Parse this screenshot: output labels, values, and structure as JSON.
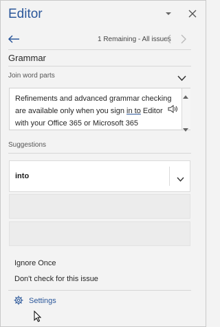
{
  "header": {
    "title": "Editor"
  },
  "navigation": {
    "issues_status": "1 Remaining - All issues"
  },
  "section": {
    "title": "Grammar",
    "error_type": "Join word parts"
  },
  "context": {
    "line1": "Refinements and advanced grammar checking",
    "line2_before": "are available only when you sign ",
    "line2_flagged": "in to",
    "line2_after": " Editor",
    "line3": "with your Office 365 or Microsoft 365"
  },
  "suggestions": {
    "label": "Suggestions",
    "items": [
      {
        "text": "into"
      }
    ]
  },
  "actions": {
    "ignore_once": "Ignore Once",
    "dont_check": "Don't check for this issue",
    "settings": "Settings"
  },
  "colors": {
    "accent": "#2b579a",
    "panel_background": "#f3f3f3"
  },
  "icons": {
    "title_dropdown": "chevron-down-icon",
    "close": "close-icon",
    "back": "back-arrow-icon",
    "previous": "chevron-left-icon",
    "next": "chevron-right-icon",
    "read_aloud": "speaker-icon",
    "settings": "gear-icon",
    "pointer": "mouse-cursor-icon"
  }
}
